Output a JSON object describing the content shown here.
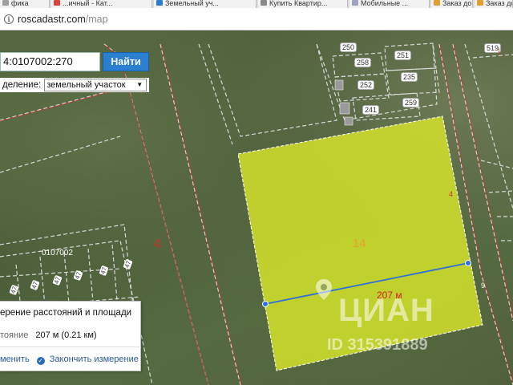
{
  "browser": {
    "tabs": [
      {
        "title": "фика",
        "color": "#9e9e9e"
      },
      {
        "title": "...ичный - Кат...",
        "color": "#d9453b"
      },
      {
        "title": "Земельный уч...",
        "color": "#2b7bd4"
      },
      {
        "title": "Купить Квартир...",
        "color": "#888888"
      },
      {
        "title": "Мобильные ...",
        "color": "#9aa3c0"
      },
      {
        "title": "Заказ документ...",
        "color": "#e0a030"
      },
      {
        "title": "Заказ документ...",
        "color": "#e0a030"
      }
    ],
    "address": {
      "domain": "roscadastr.com",
      "path": "/map"
    }
  },
  "search": {
    "value": "4:0107002:270",
    "button_label": "Найти",
    "layer_label": "деление:",
    "layer_value": "земельный участок"
  },
  "map": {
    "block_label": "0107002",
    "block_number": "4",
    "parcel_number": "14",
    "plot_numbers": [
      "250",
      "258",
      "251",
      "252",
      "235",
      "241",
      "259",
      "519"
    ],
    "small_numbers": [
      "1",
      "4",
      "9"
    ],
    "highlight_color": "#d8e62a",
    "measure_line_color": "#2f6fd8",
    "distance_label": "207 м"
  },
  "measure": {
    "title": "ерение расстояний и площади",
    "distance_label": "тояние",
    "distance_value": "207 м (0.21 км)",
    "change_label": "менить",
    "finish_label": "Закончить измерение"
  },
  "watermark": {
    "brand": "ЦИАН",
    "id_text": "ID 315391889"
  }
}
